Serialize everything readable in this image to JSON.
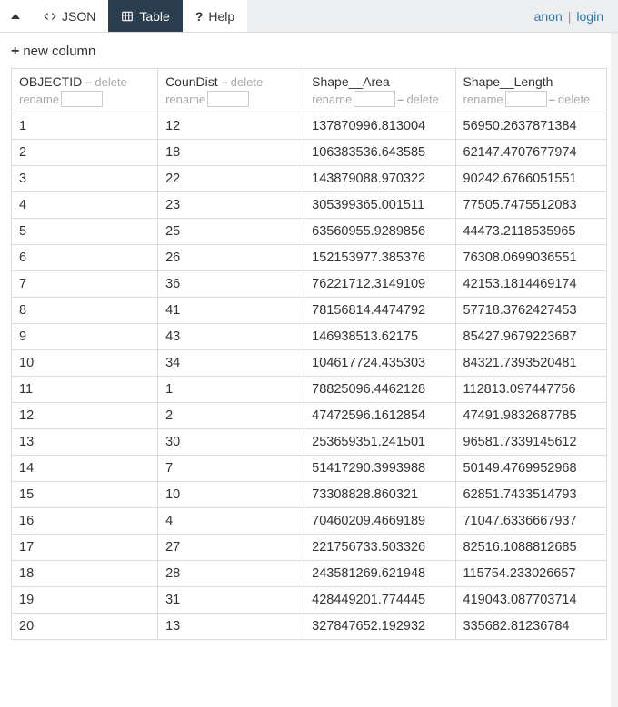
{
  "nav": {
    "tabs": {
      "json": {
        "label": "JSON"
      },
      "table": {
        "label": "Table"
      },
      "help": {
        "label": "Help"
      }
    },
    "auth": {
      "anon": "anon",
      "sep": "|",
      "login": "login"
    }
  },
  "toolbar": {
    "new_column": "new column"
  },
  "actions": {
    "delete": "delete",
    "rename": "rename"
  },
  "columns": [
    {
      "name": "OBJECTID",
      "actions": [
        "delete",
        "rename"
      ]
    },
    {
      "name": "CounDist",
      "actions": [
        "delete",
        "rename"
      ]
    },
    {
      "name": "Shape__Area",
      "actions": [
        "rename",
        "delete"
      ]
    },
    {
      "name": "Shape__Length",
      "actions": [
        "rename",
        "delete"
      ]
    }
  ],
  "rows": [
    [
      "1",
      "12",
      "137870996.813004",
      "56950.2637871384"
    ],
    [
      "2",
      "18",
      "106383536.643585",
      "62147.4707677974"
    ],
    [
      "3",
      "22",
      "143879088.970322",
      "90242.6766051551"
    ],
    [
      "4",
      "23",
      "305399365.001511",
      "77505.7475512083"
    ],
    [
      "5",
      "25",
      "63560955.9289856",
      "44473.2118535965"
    ],
    [
      "6",
      "26",
      "152153977.385376",
      "76308.0699036551"
    ],
    [
      "7",
      "36",
      "76221712.3149109",
      "42153.1814469174"
    ],
    [
      "8",
      "41",
      "78156814.4474792",
      "57718.3762427453"
    ],
    [
      "9",
      "43",
      "146938513.62175",
      "85427.9679223687"
    ],
    [
      "10",
      "34",
      "104617724.435303",
      "84321.7393520481"
    ],
    [
      "11",
      "1",
      "78825096.4462128",
      "112813.097447756"
    ],
    [
      "12",
      "2",
      "47472596.1612854",
      "47491.9832687785"
    ],
    [
      "13",
      "30",
      "253659351.241501",
      "96581.7339145612"
    ],
    [
      "14",
      "7",
      "51417290.3993988",
      "50149.4769952968"
    ],
    [
      "15",
      "10",
      "73308828.860321",
      "62851.7433514793"
    ],
    [
      "16",
      "4",
      "70460209.4669189",
      "71047.6336667937"
    ],
    [
      "17",
      "27",
      "221756733.503326",
      "82516.1088812685"
    ],
    [
      "18",
      "28",
      "243581269.621948",
      "115754.233026657"
    ],
    [
      "19",
      "31",
      "428449201.774445",
      "419043.087703714"
    ],
    [
      "20",
      "13",
      "327847652.192932",
      "335682.81236784"
    ]
  ]
}
